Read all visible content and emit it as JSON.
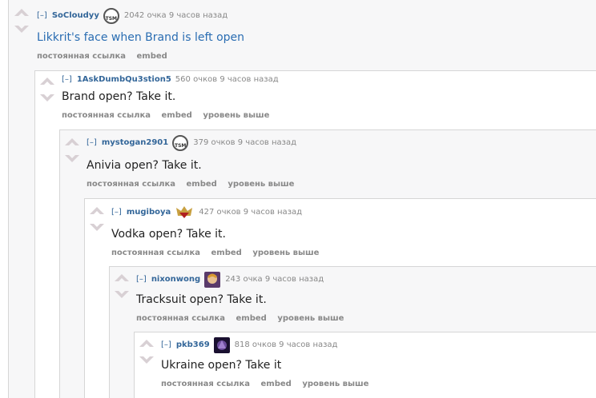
{
  "comments": [
    {
      "expand": "[–]",
      "author": "SoCloudyy",
      "flair_icon": "tsm-logo-icon",
      "meta": "2042 очка 9 часов назад",
      "body": "Likkrit's face when Brand is left open",
      "buttons": [
        "постоянная ссылка",
        "embed"
      ]
    },
    {
      "expand": "[–]",
      "author": "1AskDumbQu3stion5",
      "flair_icon": "",
      "meta": "560 очков 9 часов назад",
      "body": "Brand open? Take it.",
      "buttons": [
        "постоянная ссылка",
        "embed",
        "уровень выше"
      ]
    },
    {
      "expand": "[–]",
      "author": "mystogan2901",
      "flair_icon": "tsm-logo-icon",
      "meta": "379 очков 9 часов назад",
      "body": "Anivia open? Take it.",
      "buttons": [
        "постоянная ссылка",
        "embed",
        "уровень выше"
      ]
    },
    {
      "expand": "[–]",
      "author": "mugiboya",
      "flair_icon": "skt-logo-icon",
      "meta": "427 очков 9 часов назад",
      "body": "Vodka open? Take it.",
      "buttons": [
        "постоянная ссылка",
        "embed",
        "уровень выше"
      ]
    },
    {
      "expand": "[–]",
      "author": "nixonwong",
      "flair_icon": "champion-portrait-icon",
      "meta": "243 очка 9 часов назад",
      "body": "Tracksuit open? Take it.",
      "buttons": [
        "постоянная ссылка",
        "embed",
        "уровень выше"
      ]
    },
    {
      "expand": "[–]",
      "author": "pkb369",
      "flair_icon": "champion-portrait-icon",
      "meta": "818 очков 9 часов назад",
      "body": "Ukraine open? Take it",
      "buttons": [
        "постоянная ссылка",
        "embed",
        "уровень выше"
      ]
    }
  ],
  "colors": {
    "link": "#336699",
    "body_link": "#2a6db2",
    "meta": "#888888",
    "arrow": "#d8c8d0"
  }
}
